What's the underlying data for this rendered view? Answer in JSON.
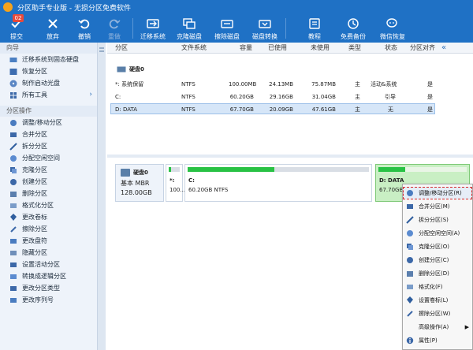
{
  "window": {
    "title": "分区助手专业版 - 无损分区免费软件"
  },
  "toolbar": {
    "buttons": [
      {
        "label": "提交",
        "badge": "02"
      },
      {
        "label": "放弃"
      },
      {
        "label": "撤销"
      },
      {
        "label": "重做"
      },
      {
        "label": "迁移系统"
      },
      {
        "label": "克隆磁盘"
      },
      {
        "label": "擦除磁盘"
      },
      {
        "label": "磁盘转换"
      },
      {
        "label": "教程"
      },
      {
        "label": "免费备份"
      },
      {
        "label": "微信恢复"
      }
    ]
  },
  "sidebar": {
    "sections": [
      {
        "title": "向导",
        "items": [
          "迁移系统到固态硬盘",
          "恢复分区",
          "制作启动光盘",
          "所有工具"
        ]
      },
      {
        "title": "分区操作",
        "items": [
          "调整/移动分区",
          "合并分区",
          "拆分分区",
          "分配空闲空间",
          "克隆分区",
          "创建分区",
          "删除分区",
          "格式化分区",
          "更改卷标",
          "擦除分区",
          "更改盘符",
          "隐藏分区",
          "设置活动分区",
          "转换成逻辑分区",
          "更改分区类型",
          "更改序列号"
        ]
      }
    ]
  },
  "table": {
    "headers": [
      "分区",
      "文件系统",
      "容量",
      "已使用",
      "未使用",
      "类型",
      "状态",
      "分区对齐"
    ],
    "disk_label": "硬盘0",
    "rows": [
      [
        "*: 系统保留",
        "NTFS",
        "100.00MB",
        "24.13MB",
        "75.87MB",
        "主",
        "活动&系统",
        "是"
      ],
      [
        "C:",
        "NTFS",
        "60.20GB",
        "29.16GB",
        "31.04GB",
        "主",
        "引导",
        "是"
      ],
      [
        "D: DATA",
        "NTFS",
        "67.70GB",
        "20.09GB",
        "47.61GB",
        "主",
        "无",
        "是"
      ]
    ]
  },
  "disk_map": {
    "disk": {
      "name": "硬盘0",
      "type": "基本 MBR",
      "size": "128.00GB"
    },
    "partitions": [
      {
        "label": "*:",
        "info": "100...",
        "used": 0.24
      },
      {
        "label": "C:",
        "info": "60.20GB NTFS",
        "used": 0.48
      },
      {
        "label": "D: DATA",
        "info": "67.70GB",
        "used": 0.3
      }
    ]
  },
  "context_menu": {
    "items": [
      {
        "label": "调整/移动分区(R)"
      },
      {
        "label": "合并分区(M)"
      },
      {
        "label": "拆分分区(S)"
      },
      {
        "label": "分配空闲空间(A)"
      },
      {
        "label": "克隆分区(O)"
      },
      {
        "label": "创建分区(C)"
      },
      {
        "label": "删除分区(D)"
      },
      {
        "label": "格式化(F)"
      },
      {
        "label": "设置卷标(L)"
      },
      {
        "label": "擦除分区(W)"
      },
      {
        "label": "高级操作(A)"
      },
      {
        "label": "属性(P)"
      }
    ]
  },
  "colors": {
    "accent": "#1f71c5",
    "used_bar": "#28c244",
    "selection": "#d6e6f8",
    "highlight_outline": "#d62a2a"
  }
}
